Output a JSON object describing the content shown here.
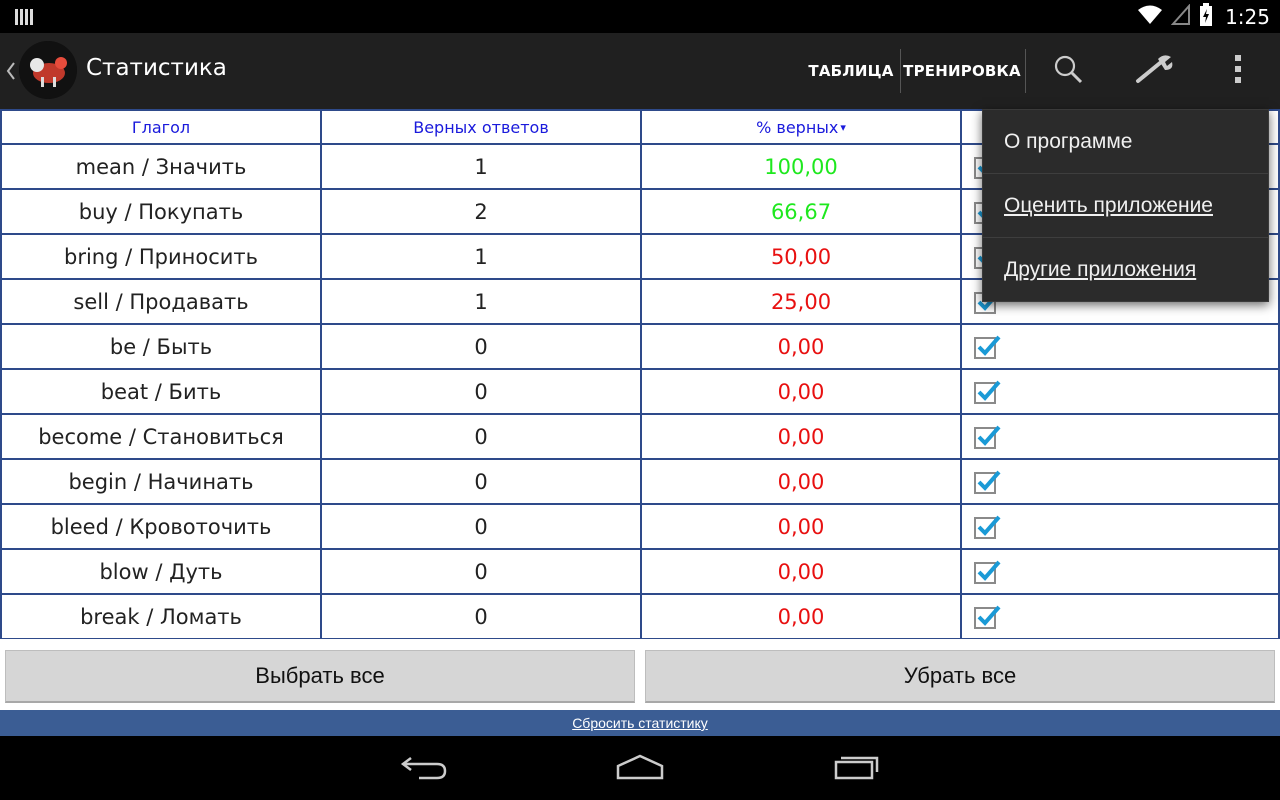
{
  "status_bar": {
    "time": "1:25"
  },
  "action_bar": {
    "title": "Статистика",
    "tabs": [
      {
        "label": "ТАБЛИЦА"
      },
      {
        "label": "ТРЕНИРОВКА"
      }
    ],
    "icons": [
      "search-icon",
      "wrench-icon",
      "overflow-menu-icon"
    ]
  },
  "table": {
    "headers": {
      "verb": "Глагол",
      "correct": "Верных ответов",
      "percent": "% верных",
      "sort_arrow": "▾"
    },
    "rows": [
      {
        "verb": "mean / Значить",
        "correct": "1",
        "percent": "100,00",
        "color": "green"
      },
      {
        "verb": "buy / Покупать",
        "correct": "2",
        "percent": "66,67",
        "color": "green"
      },
      {
        "verb": "bring / Приносить",
        "correct": "1",
        "percent": "50,00",
        "color": "red"
      },
      {
        "verb": "sell / Продавать",
        "correct": "1",
        "percent": "25,00",
        "color": "red"
      },
      {
        "verb": "be / Быть",
        "correct": "0",
        "percent": "0,00",
        "color": "red"
      },
      {
        "verb": "beat / Бить",
        "correct": "0",
        "percent": "0,00",
        "color": "red"
      },
      {
        "verb": "become / Становиться",
        "correct": "0",
        "percent": "0,00",
        "color": "red"
      },
      {
        "verb": "begin / Начинать",
        "correct": "0",
        "percent": "0,00",
        "color": "red"
      },
      {
        "verb": "bleed / Кровоточить",
        "correct": "0",
        "percent": "0,00",
        "color": "red"
      },
      {
        "verb": "blow / Дуть",
        "correct": "0",
        "percent": "0,00",
        "color": "red"
      },
      {
        "verb": "break / Ломать",
        "correct": "0",
        "percent": "0,00",
        "color": "red"
      }
    ],
    "colors": {
      "green": "#1ee81e",
      "red": "#e81010",
      "header": "#1a1adc",
      "border": "#2e4a8a"
    }
  },
  "buttons": {
    "select_all": "Выбрать все",
    "deselect_all": "Убрать все"
  },
  "reset_link": "Сбросить статистику",
  "popup_menu": {
    "items": [
      {
        "label": "О программе"
      },
      {
        "label": "Оценить приложение"
      },
      {
        "label": "Другие приложения"
      }
    ]
  }
}
